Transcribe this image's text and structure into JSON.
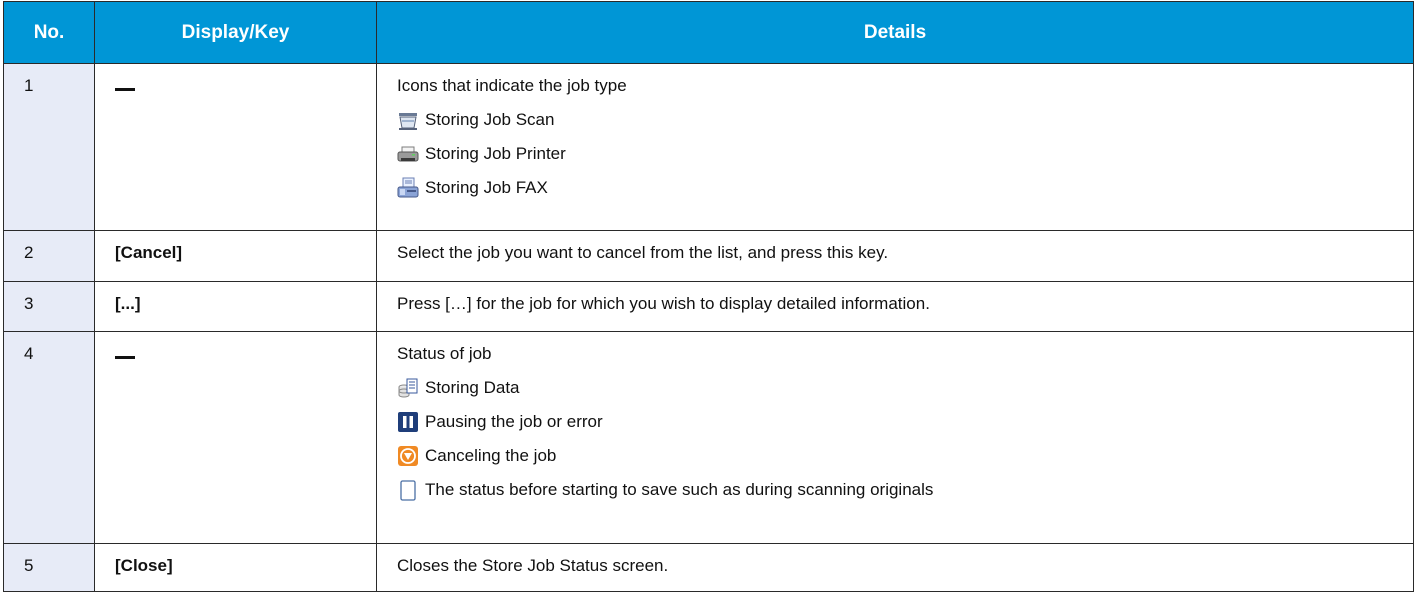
{
  "headers": {
    "no": "No.",
    "key": "Display/Key",
    "details": "Details"
  },
  "rows": [
    {
      "no": "1",
      "key": "—",
      "details": "Icons that indicate the job type",
      "items": [
        {
          "icon": "scanner-icon",
          "text": "Storing Job Scan"
        },
        {
          "icon": "printer-icon",
          "text": "Storing Job Printer"
        },
        {
          "icon": "fax-icon",
          "text": "Storing Job FAX"
        }
      ]
    },
    {
      "no": "2",
      "key": "[Cancel]",
      "details": "Select the job you want to cancel from the list, and press this key."
    },
    {
      "no": "3",
      "key": "[...]",
      "details": "Press […] for the job for which you wish to display detailed information."
    },
    {
      "no": "4",
      "key": "—",
      "details": "Status of job",
      "items": [
        {
          "icon": "storing-data-icon",
          "text": "Storing Data"
        },
        {
          "icon": "pause-icon",
          "text": "Pausing the job or error"
        },
        {
          "icon": "cancel-stop-icon",
          "text": "Canceling the job"
        },
        {
          "icon": "blank-page-icon",
          "text": "The status before starting to save such as during scanning originals"
        }
      ]
    },
    {
      "no": "5",
      "key": "[Close]",
      "details": "Closes the Store Job Status screen."
    }
  ],
  "colors": {
    "header_bg": "#0096d6",
    "header_text": "#ffffff",
    "no_column_bg": "#e7ebf7",
    "border": "#2a2a2a"
  }
}
